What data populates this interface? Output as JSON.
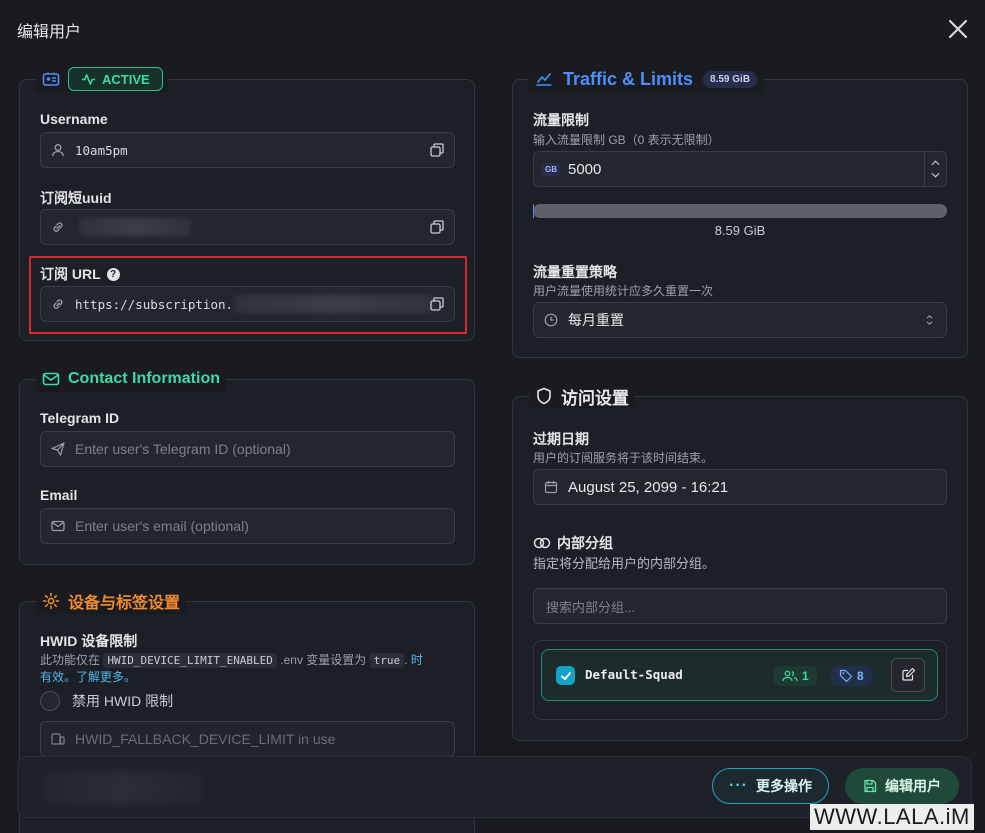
{
  "modal": {
    "title": "编辑用户"
  },
  "user_card": {
    "status": "ACTIVE",
    "username_label": "Username",
    "username_value": "10am5pm",
    "short_uuid_label": "订阅短uuid",
    "sub_url_label": "订阅 URL",
    "sub_url_value": "https://subscription."
  },
  "contact": {
    "title": "Contact Information",
    "telegram_label": "Telegram ID",
    "telegram_placeholder": "Enter user's Telegram ID (optional)",
    "email_label": "Email",
    "email_placeholder": "Enter user's email (optional)"
  },
  "device": {
    "title": "设备与标签设置",
    "hwid_label": "HWID 设备限制",
    "hwid_desc_1": "此功能仅在",
    "hwid_code_1": "HWID_DEVICE_LIMIT_ENABLED",
    "hwid_desc_2": ".env 变量设置为",
    "hwid_code_2": "true",
    "hwid_desc_3": ". 时",
    "hwid_desc_4": "有效。",
    "hwid_link": "了解更多。",
    "disable_hwid_label": "禁用 HWID 限制",
    "fallback_placeholder": "HWID_FALLBACK_DEVICE_LIMIT in use"
  },
  "traffic": {
    "title": "Traffic & Limits",
    "badge": "8.59 GiB",
    "limit_label": "流量限制",
    "limit_desc": "输入流量限制 GB（0 表示无限制）",
    "unit": "GB",
    "limit_value": "5000",
    "used_text": "8.59 GiB",
    "used_fraction": 0.0017,
    "reset_label": "流量重置策略",
    "reset_desc": "用户流量使用统计应多久重置一次",
    "reset_value": "每月重置"
  },
  "access": {
    "title": "访问设置",
    "expire_label": "过期日期",
    "expire_desc": "用户的订阅服务将于该时间结束。",
    "expire_value": "August 25, 2099 - 16:21",
    "squads_label": "内部分组",
    "squads_desc": "指定将分配给用户的内部分组。",
    "search_placeholder": "搜索内部分组...",
    "squad": {
      "name": "Default-Squad",
      "users": "1",
      "tags": "8"
    }
  },
  "footer": {
    "more_label": "更多操作",
    "save_label": "编辑用户"
  },
  "watermark": "WWW.LALA.iM",
  "colors": {
    "green": "#3fd9a4",
    "blue": "#4d8ff7",
    "orange": "#f08a2c",
    "red": "#d8262a"
  }
}
